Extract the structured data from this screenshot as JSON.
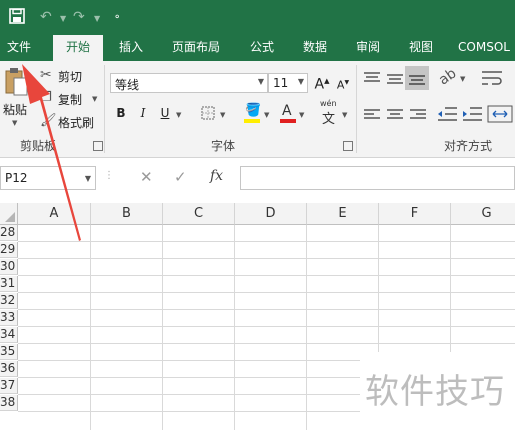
{
  "quick_access": {
    "save_icon": "save-icon",
    "undo_icon": "undo-icon",
    "redo_icon": "redo-icon",
    "customize_icon": "customize-icon"
  },
  "tabs": [
    {
      "label": "文件",
      "active": false
    },
    {
      "label": "开始",
      "active": true
    },
    {
      "label": "插入",
      "active": false
    },
    {
      "label": "页面布局",
      "active": false
    },
    {
      "label": "公式",
      "active": false
    },
    {
      "label": "数据",
      "active": false
    },
    {
      "label": "审阅",
      "active": false
    },
    {
      "label": "视图",
      "active": false
    },
    {
      "label": "COMSOL",
      "active": false
    }
  ],
  "clipboard": {
    "paste_label": "粘贴",
    "cut_label": "剪切",
    "copy_label": "复制",
    "format_painter_label": "格式刷",
    "group_label": "剪贴板"
  },
  "font": {
    "font_name": "等线",
    "font_size": "11",
    "bold": "B",
    "italic": "I",
    "underline": "U",
    "group_label": "字体",
    "phonetic_top": "wén",
    "phonetic_char": "文",
    "grow_font": "A",
    "shrink_font": "A",
    "font_color_accent": "#e02020",
    "fill_color_accent": "#ffee00"
  },
  "alignment": {
    "group_label": "对齐方式"
  },
  "formula_bar": {
    "name_box": "P12",
    "cancel_icon": "cancel-icon",
    "enter_icon": "enter-icon",
    "fx_label": "fx",
    "value": ""
  },
  "sheet": {
    "columns": [
      "A",
      "B",
      "C",
      "D",
      "E",
      "F",
      "G"
    ],
    "rows": [
      "28",
      "29",
      "30",
      "31",
      "32",
      "33",
      "34",
      "35",
      "36",
      "37",
      "38"
    ]
  },
  "watermark": "软件技巧",
  "colors": {
    "brand_green": "#217346",
    "annotation_arrow": "#e8463c"
  }
}
